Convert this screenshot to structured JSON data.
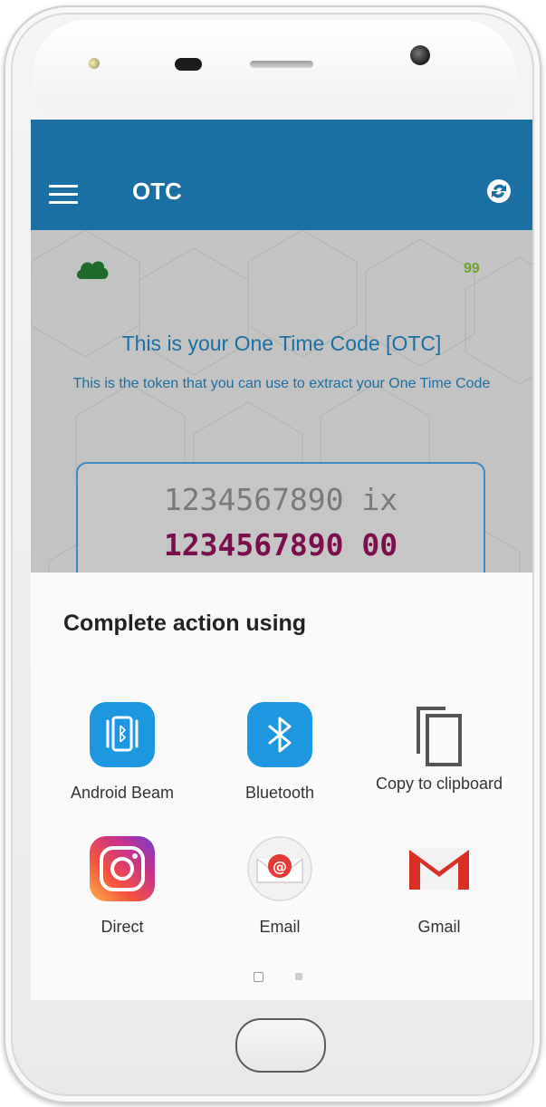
{
  "app": {
    "title": "OTC",
    "counter": "99"
  },
  "otc": {
    "heading": "This is your One Time Code [OTC]",
    "subtitle": "This is the token that you can use to extract your One Time Code",
    "code_line1": "1234567890 ix",
    "code_line2": "1234567890 00"
  },
  "share_sheet": {
    "title": "Complete action using",
    "items": [
      {
        "label": "Android Beam",
        "icon": "android-beam-icon"
      },
      {
        "label": "Bluetooth",
        "icon": "bluetooth-icon"
      },
      {
        "label": "Copy to clipboard",
        "icon": "copy-icon"
      },
      {
        "label": "Direct",
        "icon": "instagram-icon"
      },
      {
        "label": "Email",
        "icon": "email-icon"
      },
      {
        "label": "Gmail",
        "icon": "gmail-icon"
      }
    ],
    "page_count": 2,
    "current_page": 1
  },
  "colors": {
    "appbar": "#1a6fa3",
    "accent_text": "#1a6fa3",
    "code_highlight": "#7b0e4c",
    "counter": "#6aa42b",
    "cloud": "#1e6b2a"
  }
}
